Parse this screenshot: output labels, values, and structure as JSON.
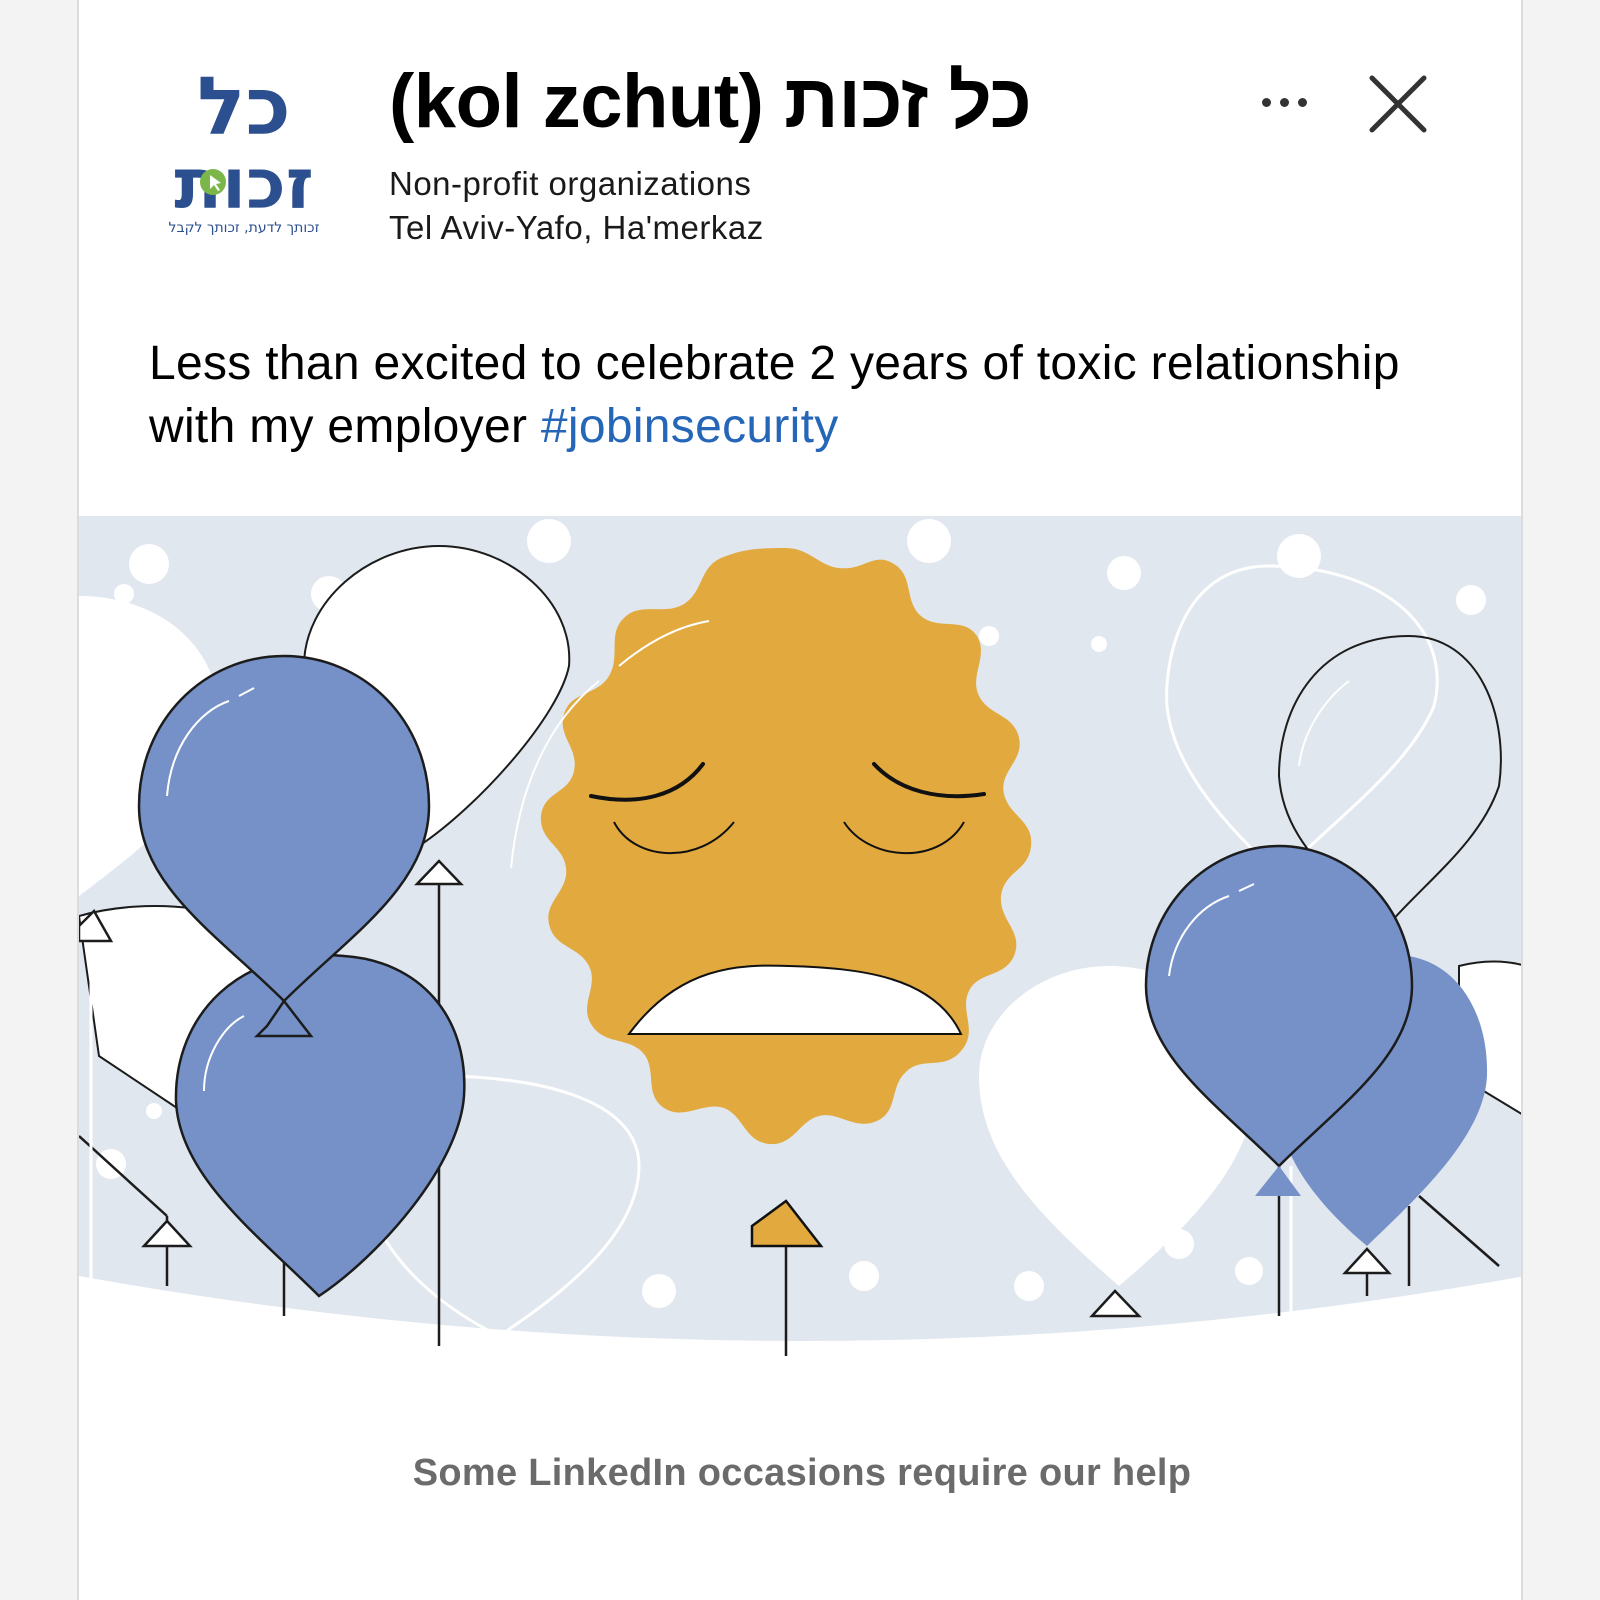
{
  "header": {
    "title": "(kol zchut) כל זכות",
    "category": "Non-profit organizations",
    "location": "Tel Aviv-Yafo, Ha'merkaz",
    "logo_text_top": "כל",
    "logo_text_bottom": "זכות",
    "logo_tagline": "זכותך לדעת, זכותך לקבל"
  },
  "post": {
    "text": "Less than excited to celebrate 2 years of toxic relationship with my employer ",
    "hashtag": "#jobinsecurity"
  },
  "footer": {
    "caption": "Some LinkedIn occasions require our help"
  },
  "icons": {
    "more": "more-options-icon",
    "close": "close-icon"
  },
  "colors": {
    "brand_blue": "#2b4f8f",
    "brand_green": "#7ab648",
    "hashtag": "#2566b8",
    "balloon_blue": "#7591c8",
    "emoji_yellow": "#e2aa3e",
    "background_band": "#e1e7ef",
    "caption_gray": "#6b6b6b"
  }
}
